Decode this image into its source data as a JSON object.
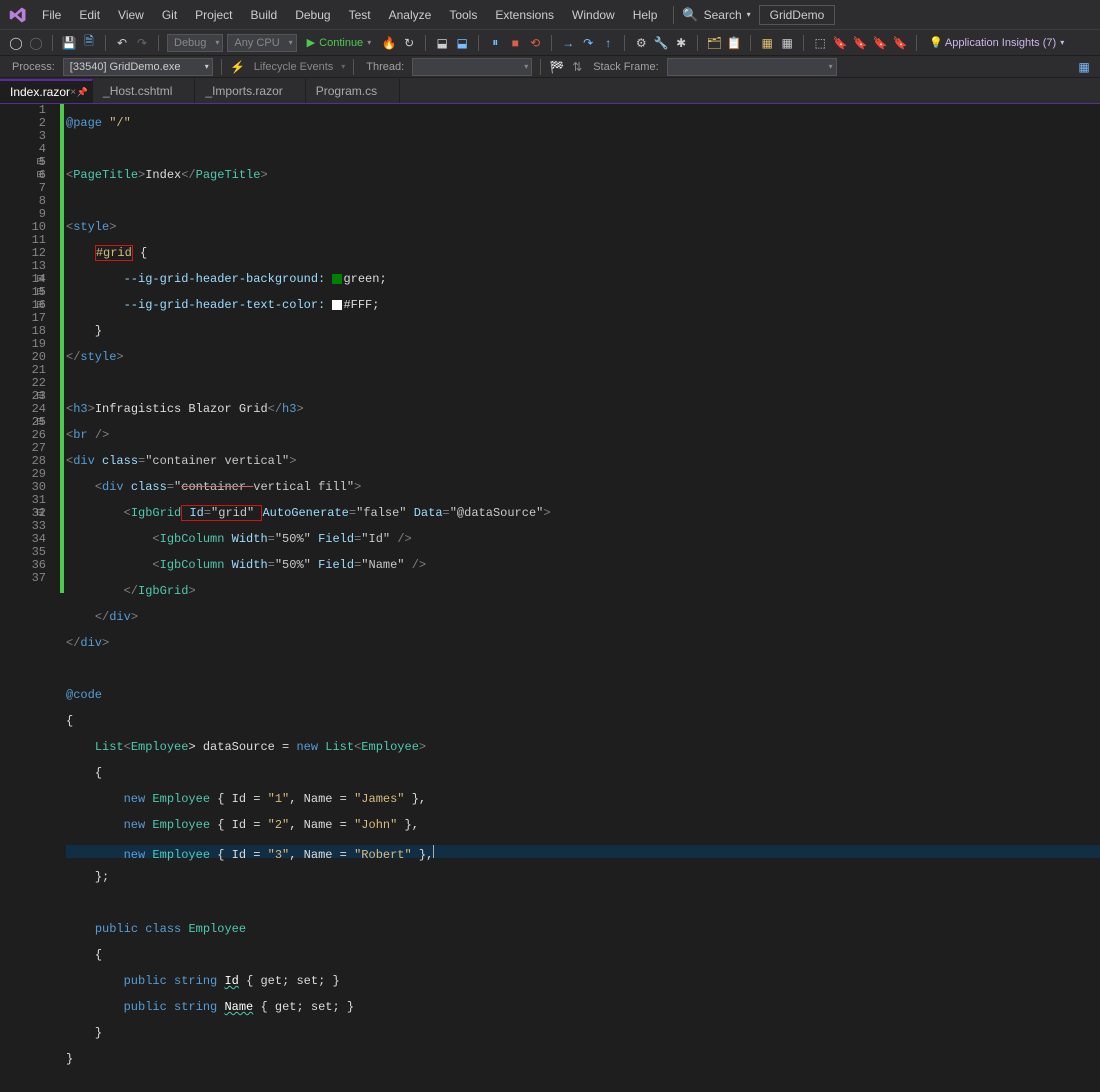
{
  "menu": {
    "items": [
      "File",
      "Edit",
      "View",
      "Git",
      "Project",
      "Build",
      "Debug",
      "Test",
      "Analyze",
      "Tools",
      "Extensions",
      "Window",
      "Help"
    ],
    "search": "Search",
    "solution": "GridDemo"
  },
  "toolbar1": {
    "config": "Debug",
    "platform": "Any CPU",
    "continue": "Continue",
    "insights": "Application Insights (7)"
  },
  "toolbar2": {
    "process_label": "Process:",
    "process": "[33540] GridDemo.exe",
    "lifecycle": "Lifecycle Events",
    "thread_label": "Thread:",
    "thread": "",
    "stack_label": "Stack Frame:",
    "stack": ""
  },
  "tabs": [
    {
      "label": "Index.razor",
      "active": true
    },
    {
      "label": "_Host.cshtml",
      "active": false
    },
    {
      "label": "_Imports.razor",
      "active": false
    },
    {
      "label": "Program.cs",
      "active": false
    }
  ],
  "code": {
    "page_dir": "@page",
    "page_val": "\"/\"",
    "pt_open": "PageTitle",
    "pt_text": "Index",
    "style_open": "style",
    "style_close": "style",
    "css_sel": "#grid",
    "css_brace": "{",
    "css_p1k": "--ig-grid-header-background:",
    "css_p1v": "green;",
    "css_p2k": "--ig-grid-header-text-color:",
    "css_p2v": "#FFF;",
    "css_brace_close": "}",
    "h3_open": "h3",
    "h3_text": "Infragistics Blazor Grid",
    "br": "br",
    "div1_open": "div",
    "div1_attr": "class",
    "div1_val": "\"container vertical\"",
    "div2_open": "div",
    "div2_attr": "class",
    "div2_val_a": "container ",
    "div2_val_b": "vertical fill",
    "grid_tag": "IgbGrid",
    "grid_id_k": "Id",
    "grid_id_v": "\"grid\"",
    "grid_auto_k": "AutoGenerate",
    "grid_auto_v": "\"false\"",
    "grid_data_k": "Data",
    "grid_data_v": "\"@dataSource\"",
    "col_tag": "IgbColumn",
    "col_w_k": "Width",
    "col_w_v": "\"50%\"",
    "col_f_k": "Field",
    "col_f1": "\"Id\"",
    "col_f2": "\"Name\"",
    "code_dir": "@code",
    "list_decl_1": "List",
    "list_decl_2": "Employee",
    "list_decl_3": "> dataSource = ",
    "new_kw": "new",
    "list_decl_4": "List",
    "list_decl_5": "Employee",
    "emp_type": "Employee",
    "emp_id": "Id",
    "emp_name": "Name",
    "e1_id": "\"1\"",
    "e1_name": "\"James\"",
    "e2_id": "\"2\"",
    "e2_name": "\"John\"",
    "e3_id": "\"3\"",
    "e3_name": "\"Robert\"",
    "public_kw": "public",
    "class_kw": "class",
    "string_kw": "string",
    "get_set": "{ get; set; }",
    "cls_name": "Employee",
    "cls_name_u": "Employee",
    "prop_id": "Id",
    "prop_name": "Name"
  },
  "lines": 37
}
